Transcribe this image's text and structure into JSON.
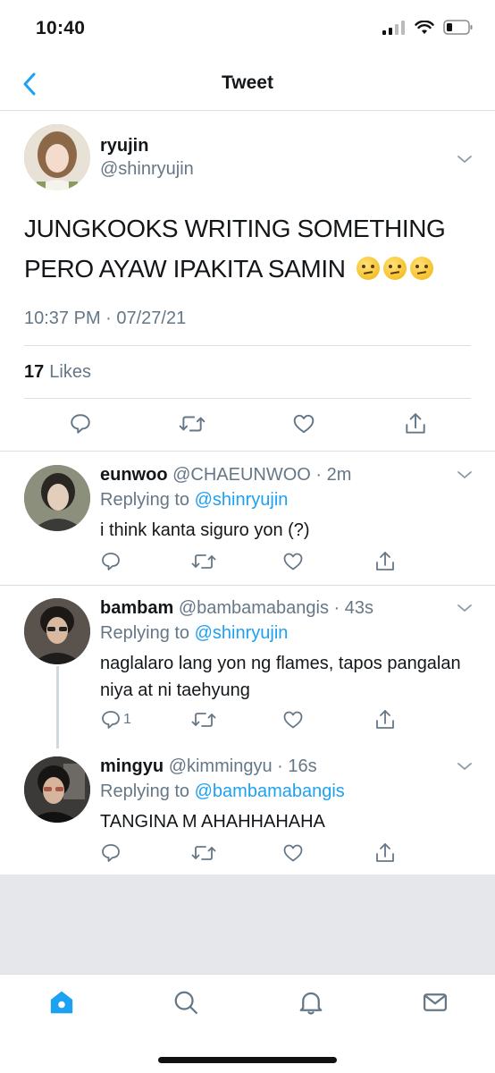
{
  "status_bar": {
    "time": "10:40"
  },
  "header": {
    "title": "Tweet"
  },
  "main_tweet": {
    "name": "ryujin",
    "handle": "@shinryujin",
    "text": "JUNGKOOKS WRITING SOMETHING PERO AYAW IPAKITA SAMIN",
    "emoji": [
      "face-with-raised-eyebrow",
      "face-with-raised-eyebrow",
      "face-with-raised-eyebrow"
    ],
    "timestamp": "10:37 PM · 07/27/21",
    "likes_count": "17",
    "likes_label": "Likes"
  },
  "replies": [
    {
      "name": "eunwoo",
      "meta": "@CHAEUNWOO · 2m",
      "replying_prefix": "Replying to",
      "replying_to": "@shinryujin",
      "text": "i think kanta siguro yon (?)",
      "reply_count": ""
    },
    {
      "name": "bambam",
      "meta": "@bambamabangis · 43s",
      "replying_prefix": "Replying to",
      "replying_to": "@shinryujin",
      "text": "naglalaro lang yon ng flames, tapos pangalan niya at ni taehyung",
      "reply_count": "1"
    },
    {
      "name": "mingyu",
      "meta": "@kimmingyu · 16s",
      "replying_prefix": "Replying to",
      "replying_to": "@bambamabangis",
      "text": "TANGINA M AHAHHAHAHA",
      "reply_count": ""
    }
  ],
  "tab_bar": {
    "items": [
      "home-icon",
      "search-icon",
      "bell-icon",
      "mail-icon"
    ]
  },
  "colors": {
    "accent": "#1da1f2",
    "muted": "#657786",
    "divider": "#dcdfe3"
  }
}
